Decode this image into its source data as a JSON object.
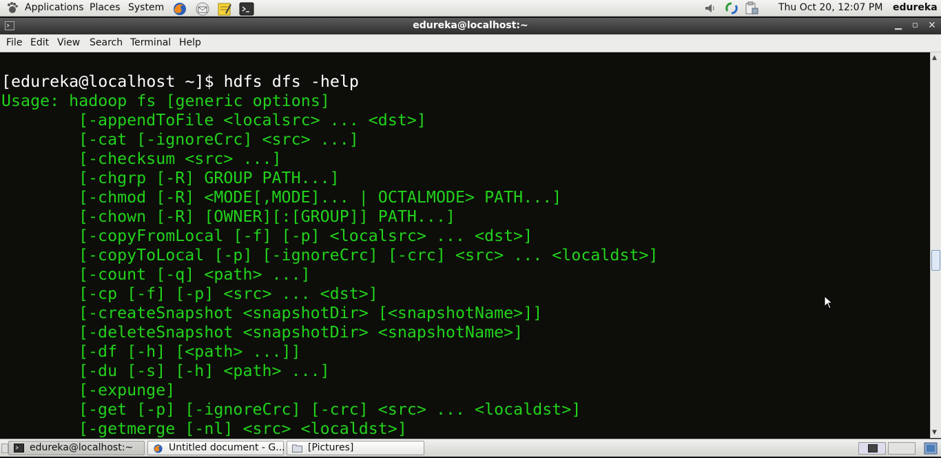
{
  "top_panel": {
    "menus": [
      "Applications",
      "Places",
      "System"
    ],
    "launchers": [
      "firefox-icon",
      "mail-icon",
      "notes-icon",
      "terminal-icon"
    ],
    "datetime": "Thu Oct 20, 12:07 PM",
    "user": "edureka"
  },
  "window": {
    "title": "edureka@localhost:~",
    "menus": [
      "File",
      "Edit",
      "View",
      "Search",
      "Terminal",
      "Help"
    ]
  },
  "terminal": {
    "prompt_line": "[edureka@localhost ~]$ hdfs dfs -help",
    "usage_line": "Usage: hadoop fs [generic options]",
    "options": [
      "[-appendToFile <localsrc> ... <dst>]",
      "[-cat [-ignoreCrc] <src> ...]",
      "[-checksum <src> ...]",
      "[-chgrp [-R] GROUP PATH...]",
      "[-chmod [-R] <MODE[,MODE]... | OCTALMODE> PATH...]",
      "[-chown [-R] [OWNER][:[GROUP]] PATH...]",
      "[-copyFromLocal [-f] [-p] <localsrc> ... <dst>]",
      "[-copyToLocal [-p] [-ignoreCrc] [-crc] <src> ... <localdst>]",
      "[-count [-q] <path> ...]",
      "[-cp [-f] [-p] <src> ... <dst>]",
      "[-createSnapshot <snapshotDir> [<snapshotName>]]",
      "[-deleteSnapshot <snapshotDir> <snapshotName>]",
      "[-df [-h] [<path> ...]]",
      "[-du [-s] [-h] <path> ...]",
      "[-expunge]",
      "[-get [-p] [-ignoreCrc] [-crc] <src> ... <localdst>]",
      "[-getmerge [-nl] <src> <localdst>]"
    ],
    "fg_color": "#22d21c",
    "bg_color": "#0d0d09"
  },
  "taskbar": {
    "tasks": [
      {
        "label": "edureka@localhost:~",
        "icon": "terminal-icon"
      },
      {
        "label": "Untitled document - G...",
        "icon": "firefox-icon"
      },
      {
        "label": "[Pictures]",
        "icon": "folder-icon"
      }
    ]
  }
}
